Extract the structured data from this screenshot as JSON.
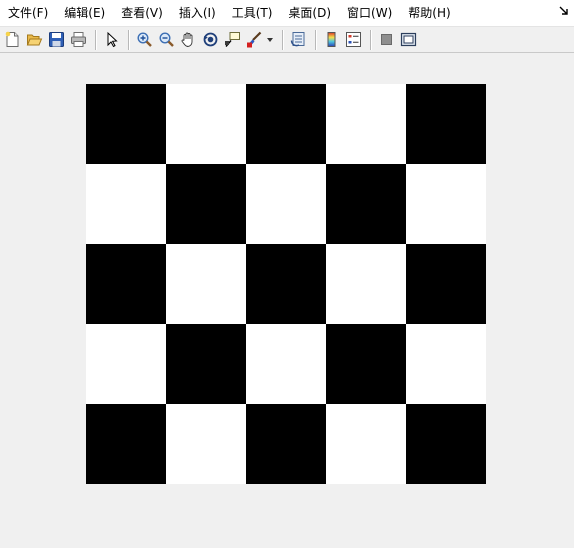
{
  "menubar": {
    "items": [
      {
        "id": "file",
        "label": "文件(F)"
      },
      {
        "id": "edit",
        "label": "编辑(E)"
      },
      {
        "id": "view",
        "label": "查看(V)"
      },
      {
        "id": "insert",
        "label": "插入(I)"
      },
      {
        "id": "tools",
        "label": "工具(T)"
      },
      {
        "id": "desktop",
        "label": "桌面(D)"
      },
      {
        "id": "window",
        "label": "窗口(W)"
      },
      {
        "id": "help",
        "label": "帮助(H)"
      }
    ],
    "dock_icon": "dock-arrow-icon"
  },
  "toolbar": {
    "buttons": [
      {
        "icon": "new-figure-icon"
      },
      {
        "icon": "open-file-icon"
      },
      {
        "icon": "save-icon"
      },
      {
        "icon": "print-icon"
      },
      {
        "icon": "edit-plot-arrow-icon"
      },
      {
        "icon": "zoom-in-icon"
      },
      {
        "icon": "zoom-out-icon"
      },
      {
        "icon": "pan-hand-icon"
      },
      {
        "icon": "rotate-3d-icon"
      },
      {
        "icon": "data-cursor-icon"
      },
      {
        "icon": "brush-icon"
      },
      {
        "icon": "link-plot-icon"
      },
      {
        "icon": "colorbar-icon"
      },
      {
        "icon": "legend-icon"
      },
      {
        "icon": "hide-plot-tools-icon"
      },
      {
        "icon": "show-plot-tools-icon"
      }
    ]
  },
  "figure": {
    "rows": 5,
    "cols": 5,
    "pattern": [
      [
        1,
        0,
        1,
        0,
        1
      ],
      [
        0,
        1,
        0,
        1,
        0
      ],
      [
        1,
        0,
        1,
        0,
        1
      ],
      [
        0,
        1,
        0,
        1,
        0
      ],
      [
        1,
        0,
        1,
        0,
        1
      ]
    ],
    "colors": {
      "dark": "#000000",
      "light": "#ffffff",
      "background": "#f0f0f0"
    }
  }
}
